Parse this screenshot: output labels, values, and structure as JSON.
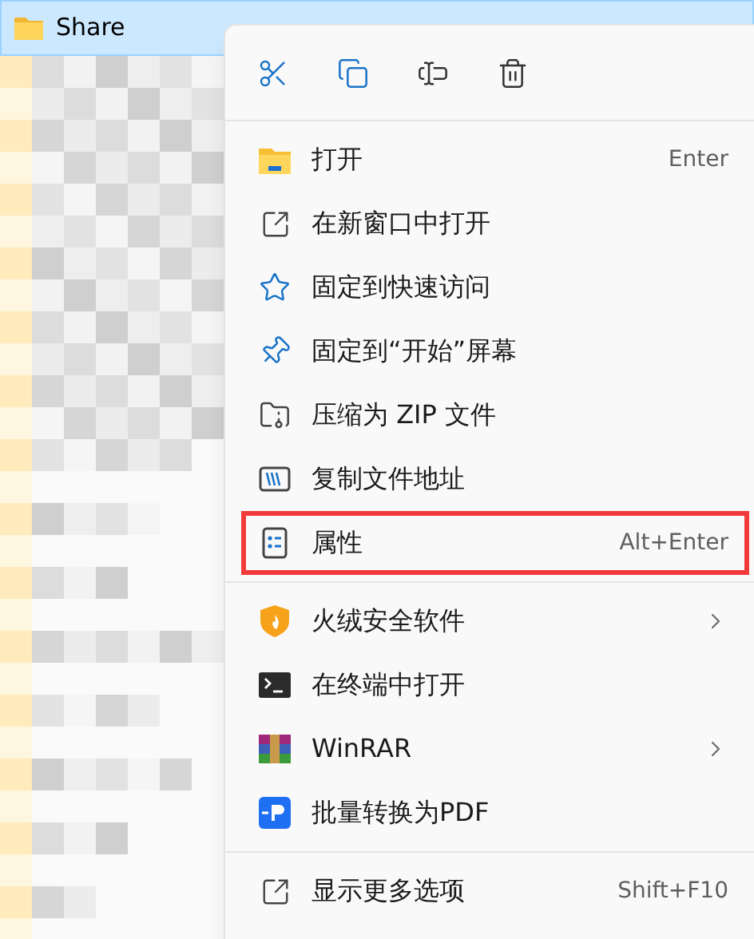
{
  "file_row": {
    "name": "Share",
    "selected": true
  },
  "menu": {
    "toolbar": [
      {
        "kind": "cut"
      },
      {
        "kind": "copy"
      },
      {
        "kind": "rename"
      },
      {
        "kind": "delete"
      }
    ],
    "groups": [
      [
        {
          "label": "打开",
          "shortcut": "Enter",
          "submenu": false,
          "outlined": false
        },
        {
          "label": "在新窗口中打开",
          "submenu": false,
          "outlined": false
        },
        {
          "label": "固定到快速访问",
          "submenu": false,
          "outlined": false
        },
        {
          "label": "固定到“开始”屏幕",
          "submenu": false,
          "outlined": false
        },
        {
          "label": "压缩为 ZIP 文件",
          "submenu": false,
          "outlined": false
        },
        {
          "label": "复制文件地址",
          "submenu": false,
          "outlined": false
        },
        {
          "label": "属性",
          "shortcut": "Alt+Enter",
          "submenu": false,
          "outlined": true
        }
      ],
      [
        {
          "label": "火绒安全软件",
          "submenu": true,
          "outlined": false
        },
        {
          "label": "在终端中打开",
          "submenu": false,
          "outlined": false
        },
        {
          "label": "WinRAR",
          "submenu": true,
          "outlined": false
        },
        {
          "label": "批量转换为PDF",
          "submenu": false,
          "outlined": false
        }
      ],
      [
        {
          "label": "显示更多选项",
          "shortcut": "Shift+F10",
          "submenu": false,
          "outlined": false
        }
      ]
    ]
  }
}
